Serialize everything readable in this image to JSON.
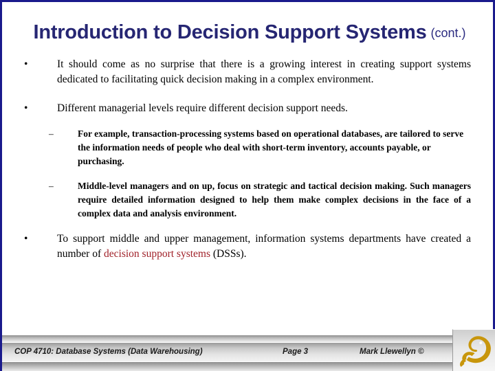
{
  "slide": {
    "title": {
      "main": "Introduction to Decision Support Systems",
      "cont": "(cont.)"
    },
    "bullets": [
      {
        "marker": "•",
        "level": 1,
        "text": "It should come as no surprise that there is a growing interest in creating support systems dedicated to facilitating quick decision making in a complex environment."
      },
      {
        "marker": "•",
        "level": 1,
        "text": "Different managerial levels require different decision support needs."
      },
      {
        "marker": "–",
        "level": 2,
        "text": "For example, transaction-processing systems based on operational databases, are tailored to serve the information needs of people who deal with short-term inventory, accounts payable, or purchasing."
      },
      {
        "marker": "–",
        "level": 2,
        "text": "Middle-level managers and on up, focus on strategic and tactical decision making.  Such managers require detailed information designed to help them make complex decisions in the face of a complex data and analysis environment."
      },
      {
        "marker": "•",
        "level": 1,
        "text_before": "To support middle and upper management, information systems departments have created a number of ",
        "text_highlight": "decision support systems",
        "text_after": " (DSSs)."
      }
    ]
  },
  "footer": {
    "course": "COP 4710: Database Systems  (Data Warehousing)",
    "page": "Page 3",
    "author": "Mark Llewellyn ©",
    "logo_name": "ucf-pegasus-logo"
  },
  "colors": {
    "title": "#262673",
    "border": "#1a1a8c",
    "highlight_red": "#a02129",
    "logo_gold": "#c8960c",
    "footer_gray": "#c9c9c9"
  }
}
